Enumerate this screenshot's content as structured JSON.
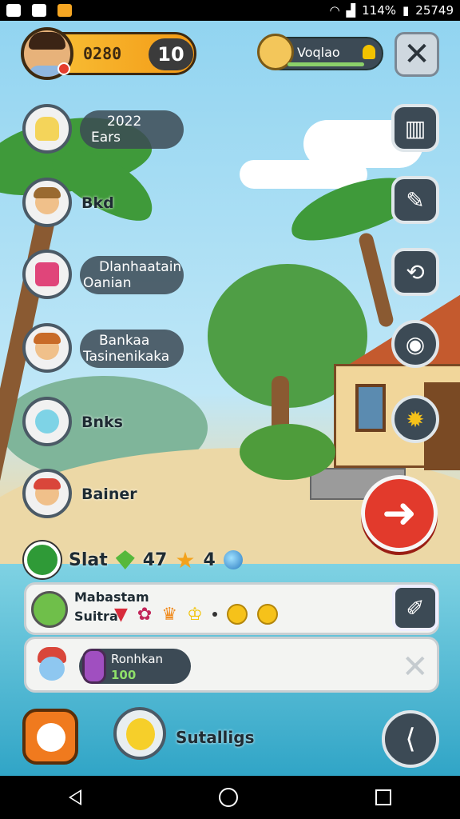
{
  "status_bar": {
    "battery_text": "114%",
    "time": "25749"
  },
  "player": {
    "coins": "0280",
    "level": "10"
  },
  "friend": {
    "name": "Voqlao"
  },
  "menu": [
    {
      "line1": "2022",
      "line2": "Ears"
    },
    {
      "line1": "Bkd",
      "line2": ""
    },
    {
      "line1": "Dlanhaatain",
      "line2": "Oanian"
    },
    {
      "line1": "Bankaa",
      "line2": "Tasinenikaka"
    },
    {
      "line1": "Bnks",
      "line2": ""
    },
    {
      "line1": "Bainer",
      "line2": ""
    }
  ],
  "stats": {
    "label": "Slat",
    "value1": "47",
    "value2": "4"
  },
  "quest_panel": {
    "title": "Mabastam",
    "subtitle": "Suitra"
  },
  "reward_panel": {
    "title": "Ronhkan",
    "value": "100"
  },
  "bottom": {
    "settings_label": "Sutalligs"
  },
  "icons": {
    "close": "close-icon",
    "go": "arrow-right-icon",
    "share": "share-icon",
    "edit": "edit-icon",
    "bell": "bell-icon"
  },
  "colors": {
    "accent": "#f39a16",
    "go": "#e23a2c",
    "panel": "#3c4a55"
  }
}
